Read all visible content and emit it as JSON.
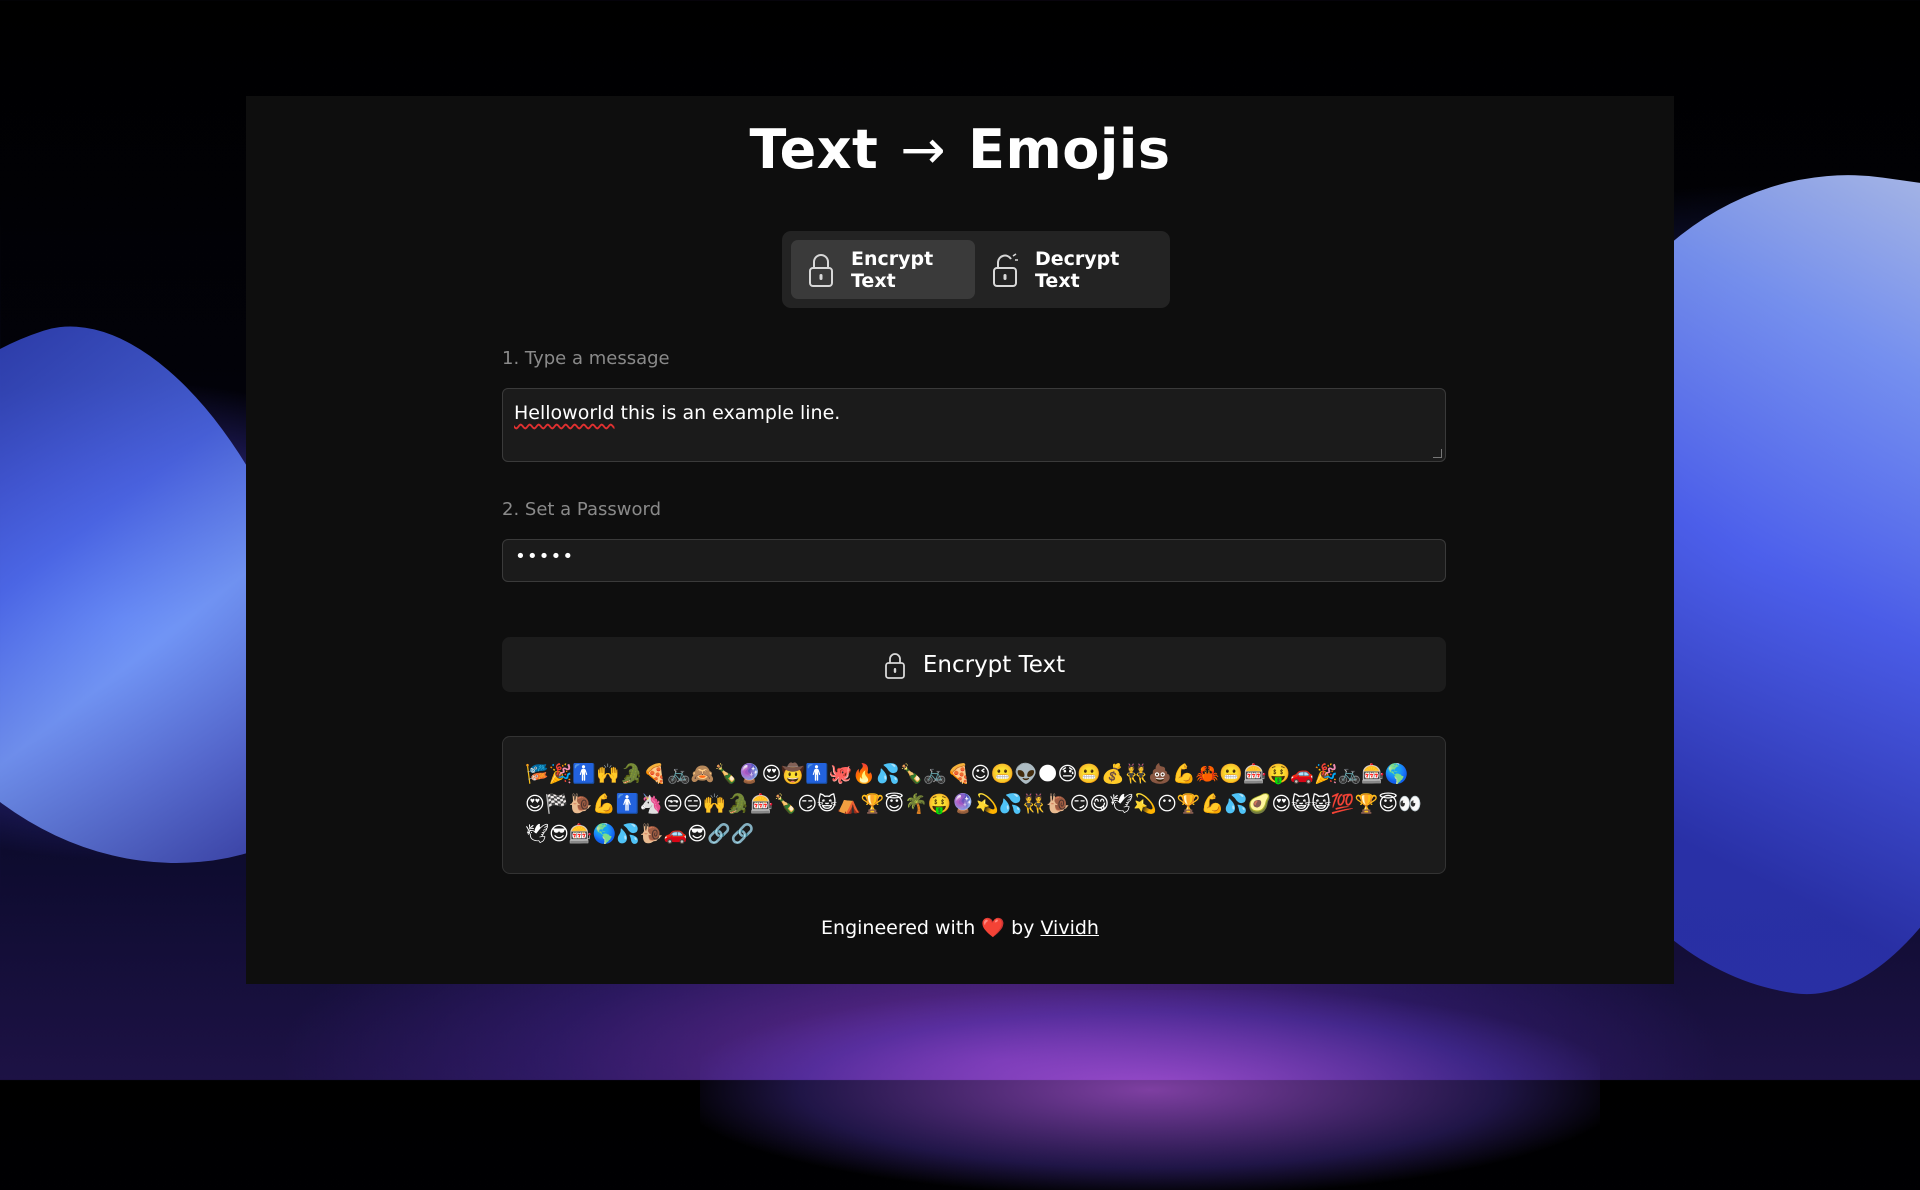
{
  "title": {
    "left": "Text",
    "arrow": "→",
    "right": "Emojis"
  },
  "tabs": [
    {
      "label": "Encrypt Text",
      "icon": "lock-icon",
      "active": true
    },
    {
      "label": "Decrypt Text",
      "icon": "unlock-icon",
      "active": false
    }
  ],
  "message": {
    "label": "1. Type a message",
    "value_first_word": "Helloworld",
    "value_rest": " this is an example line."
  },
  "password": {
    "label": "2. Set a Password",
    "value": "•••••"
  },
  "encrypt_button": {
    "label": "Encrypt Text",
    "icon": "lock-icon"
  },
  "output": {
    "value": "🎏🎉🚹🙌🐊🍕🚲🙈🍾🔮😍🤠🚹🐙🔥💦🍾🚲🍕😉😬👽🌑😓😬💰👯💩💪🦀😬🎰🤑🚗🎉🚲🎰🌎😍🏁🐌💪🚹🦄😒😑🙌🐊🎰🍾😏😺⛺🏆😇🌴🤑🔮💫💦👯🐌😏😋🕊💫😶🏆💪💦🥑😍😺😺💯🏆😇👀🕊😎🎰🌎💦🐌🚗😎🔗🔗"
  },
  "footer": {
    "prefix": "Engineered with",
    "heart": "❤️",
    "by": "by",
    "author": "Vividh"
  },
  "colors": {
    "panel_bg": "#0e0e0e",
    "field_bg": "#1b1b1b",
    "tab_active_bg": "#3a3a3a",
    "label_gray": "#8a8a8a",
    "heart_red": "#e0242e"
  }
}
